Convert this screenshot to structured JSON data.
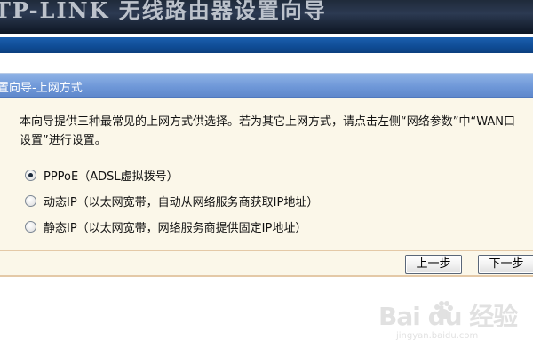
{
  "banner": {
    "text": "TP-LINK 无线路由器设置向导"
  },
  "panel": {
    "title": "置向导-上网方式",
    "description": "本向导提供三种最常见的上网方式供选择。若为其它上网方式，请点击左侧“网络参数”中“WAN口设置”进行设置。"
  },
  "options": [
    {
      "label": "PPPoE（ADSL虚拟拨号）",
      "checked": true
    },
    {
      "label": "动态IP（以太网宽带，自动从网络服务商获取IP地址）",
      "checked": false
    },
    {
      "label": "静态IP（以太网宽带，网络服务商提供固定IP地址）",
      "checked": false
    }
  ],
  "buttons": {
    "prev": "上一步",
    "next": "下一步"
  },
  "watermark": {
    "main": "Bai du 经验",
    "sub": "jingyan.baidu.com"
  },
  "colors": {
    "header_blue": "#6f98d8",
    "panel_bg": "#fbf7e9",
    "top_bar": "#0f4c95"
  }
}
